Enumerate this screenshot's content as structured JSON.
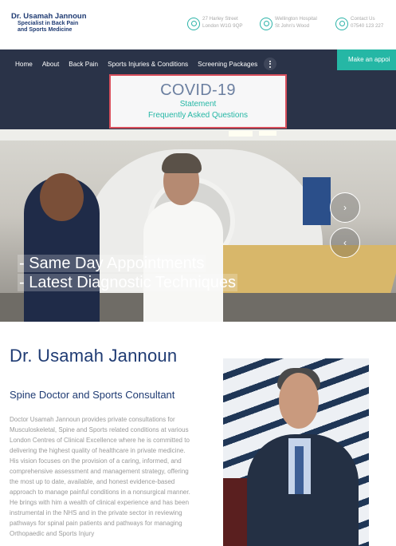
{
  "header": {
    "logo_line1": "Dr. Usamah Jannoun",
    "logo_line2": "Specialist in Back Pain",
    "logo_line3": "and Sports Medicine",
    "contacts": [
      {
        "icon": "location-pin-icon",
        "line1": "27 Harley Street",
        "line2": "London W1G 9QP"
      },
      {
        "icon": "location-pin-icon",
        "line1": "Wellington Hospital",
        "line2": "St John's Wood"
      },
      {
        "icon": "phone-icon",
        "line1": "Contact Us",
        "line2": "07540 123 227"
      }
    ]
  },
  "nav": {
    "items": [
      "Home",
      "About",
      "Back Pain",
      "Sports Injuries & Conditions",
      "Screening Packages"
    ],
    "more_icon": "more-vertical-icon",
    "appointment_label": "Make an appoi"
  },
  "covid": {
    "title": "COVID-19",
    "link1": "Statement",
    "link2": "Frequently Asked Questions"
  },
  "hero": {
    "line1": "- Same Day Appointments",
    "line2": "- Latest Diagnostic Techniques",
    "next_icon": "chevron-right-icon",
    "prev_icon": "chevron-left-icon"
  },
  "about": {
    "name": "Dr. Usamah Jannoun",
    "role": "Spine Doctor and Sports Consultant",
    "bio": "Doctor Usamah Jannoun provides private consultations for Musculoskeletal, Spine and Sports related conditions at various London Centres of Clinical Excellence where he is committed to delivering the highest quality of healthcare in private medicine. His vision focuses on the provision of a caring, informed, and comprehensive assessment and management strategy, offering the most up to date, available, and honest evidence-based approach to manage painful conditions in a nonsurgical manner. He brings with him a wealth of clinical experience and has been instrumental in the NHS and in the private sector in reviewing pathways for spinal pain patients and pathways for managing Orthopaedic and Sports Injury"
  },
  "colors": {
    "nav_bg": "#2a3348",
    "accent_teal": "#25b7a5",
    "brand_navy": "#1f3b73",
    "covid_border": "#d9505d"
  }
}
